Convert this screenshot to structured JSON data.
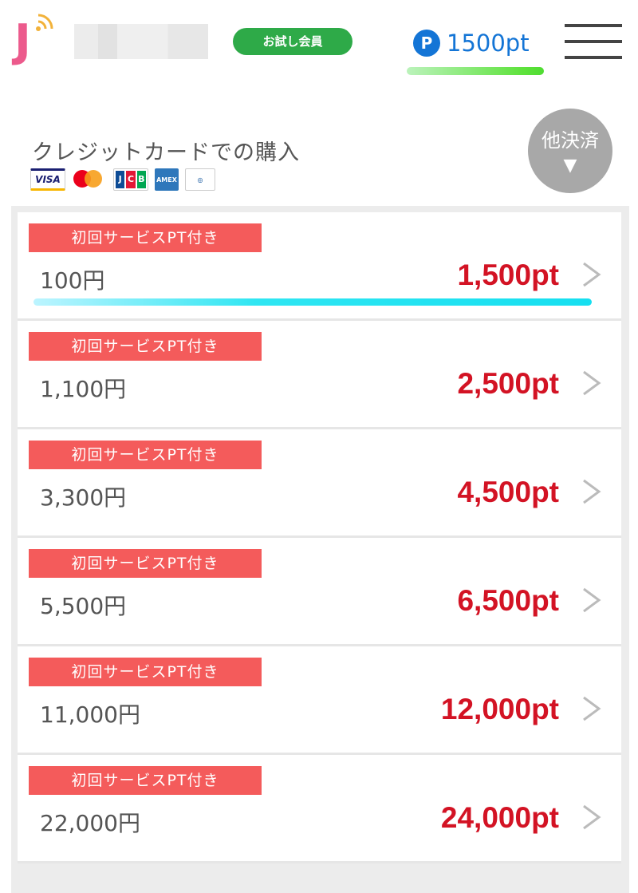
{
  "header": {
    "logo_letter": "J",
    "member_badge": "お試し会員",
    "points_icon": "P",
    "points_value": "1500pt",
    "menu_icon": "hamburger-menu-icon"
  },
  "purchase": {
    "title": "クレジットカードでの購入",
    "cards": [
      "VISA",
      "Mastercard",
      "JCB",
      "AMERICAN EXPRESS",
      "Diners Club"
    ],
    "other_payment_label": "他決済",
    "other_payment_arrow": "▼"
  },
  "plans": [
    {
      "tag": "初回サービスPT付き",
      "price": "100円",
      "points": "1,500pt"
    },
    {
      "tag": "初回サービスPT付き",
      "price": "1,100円",
      "points": "2,500pt"
    },
    {
      "tag": "初回サービスPT付き",
      "price": "3,300円",
      "points": "4,500pt"
    },
    {
      "tag": "初回サービスPT付き",
      "price": "5,500円",
      "points": "6,500pt"
    },
    {
      "tag": "初回サービスPT付き",
      "price": "11,000円",
      "points": "12,000pt"
    },
    {
      "tag": "初回サービスPT付き",
      "price": "22,000円",
      "points": "24,000pt"
    }
  ],
  "colors": {
    "accent_red": "#d31324",
    "tag_red": "#f45b5b",
    "points_blue": "#1475d6",
    "badge_green": "#2eaa48"
  }
}
